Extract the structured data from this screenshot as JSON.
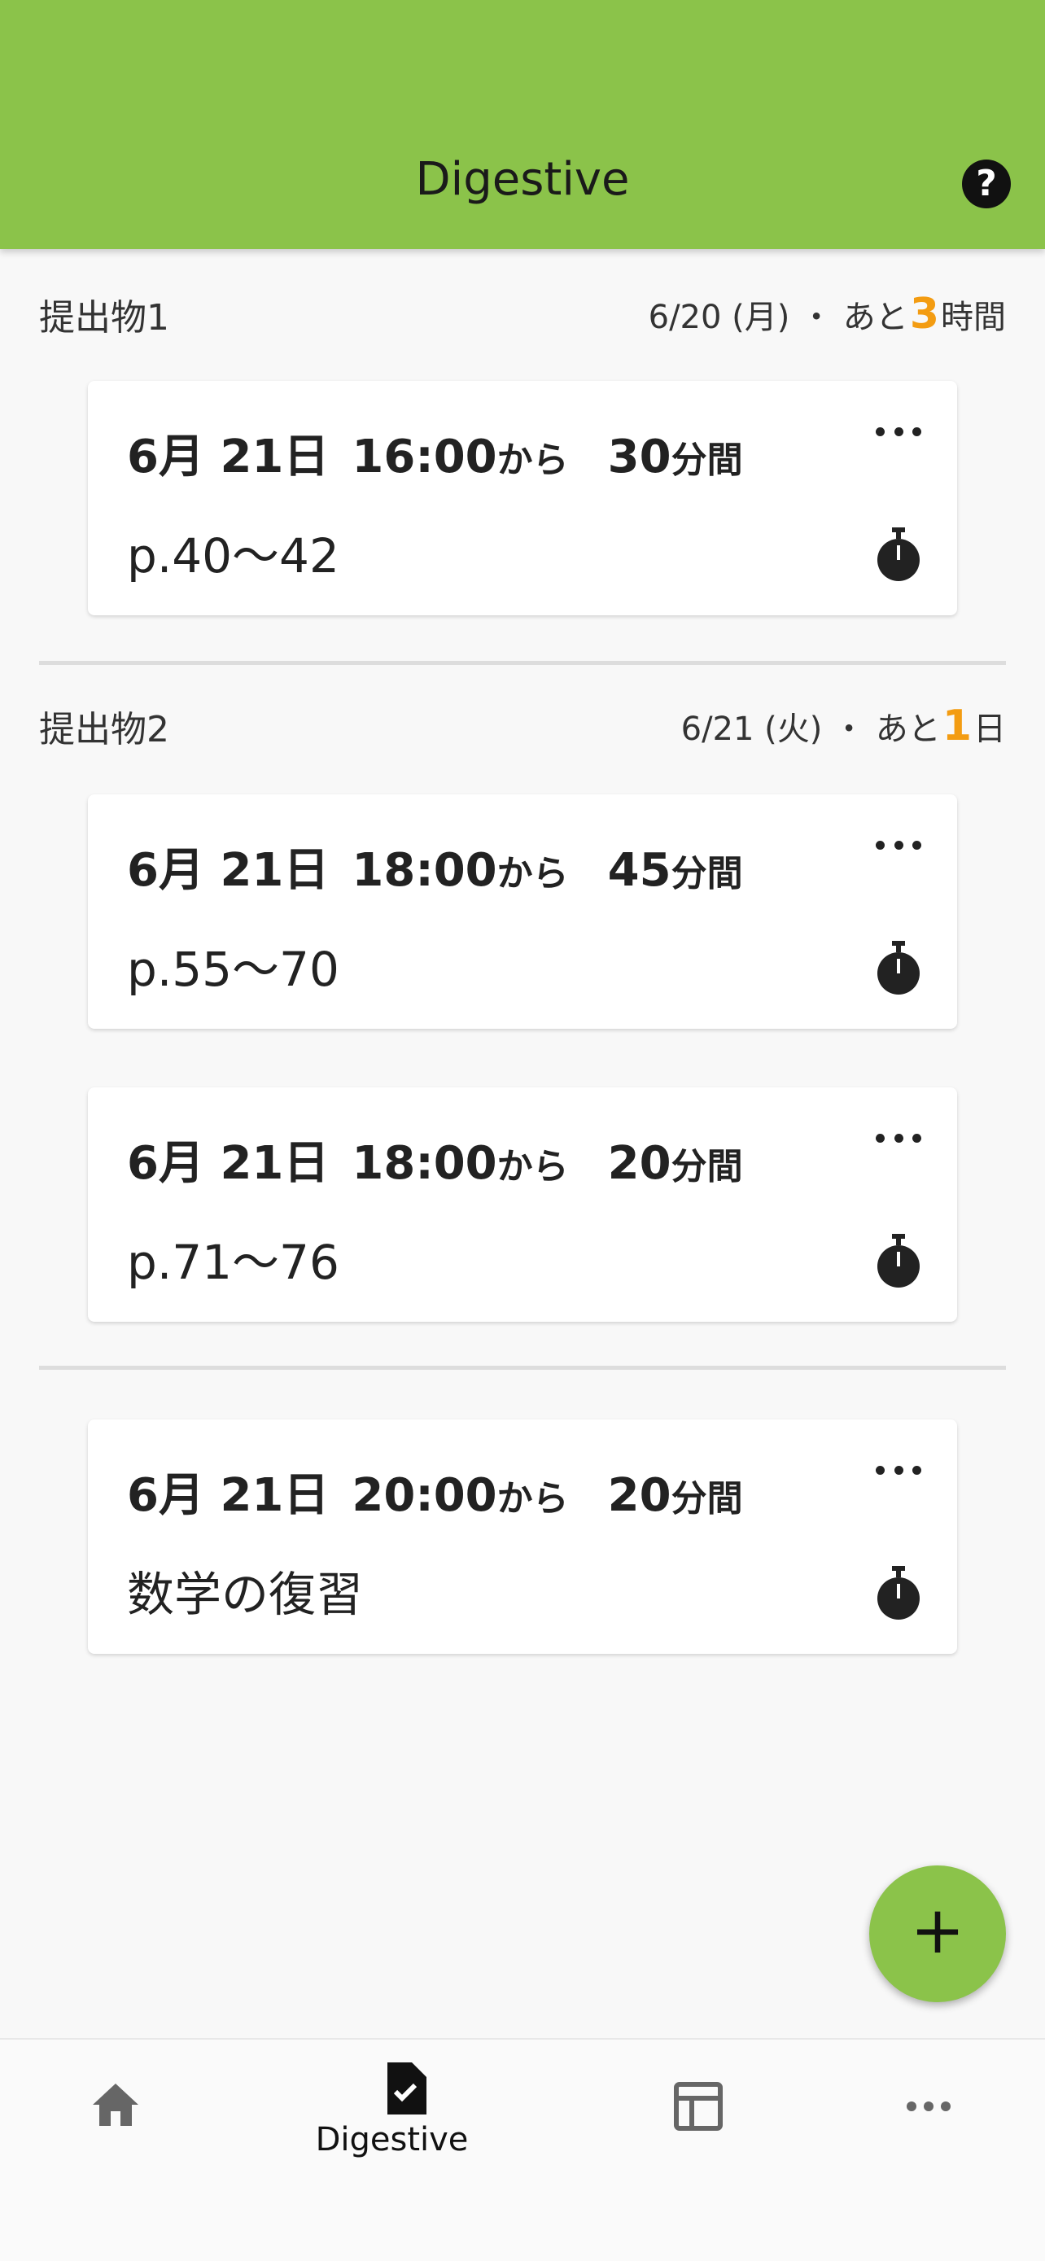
{
  "appbar": {
    "title": "Digestive",
    "help_icon": "help-circle-icon"
  },
  "groups": [
    {
      "name": "提出物1",
      "due_date": "6/20 (月) ・ あと",
      "remaining_num": "3",
      "remaining_unit": "時間",
      "tasks": [
        {
          "date": "6月 21日",
          "time": "16:00",
          "from": "から",
          "duration_num": "30",
          "duration_unit": "分間",
          "range": "p.40〜42"
        }
      ]
    },
    {
      "name": "提出物2",
      "due_date": "6/21 (火) ・ あと",
      "remaining_num": "1",
      "remaining_unit": "日",
      "tasks": [
        {
          "date": "6月 21日",
          "time": "18:00",
          "from": "から",
          "duration_num": "45",
          "duration_unit": "分間",
          "range": "p.55〜70"
        },
        {
          "date": "6月 21日",
          "time": "18:00",
          "from": "から",
          "duration_num": "20",
          "duration_unit": "分間",
          "range": "p.71〜76"
        }
      ]
    }
  ],
  "ungrouped_tasks": [
    {
      "date": "6月 21日",
      "time": "20:00",
      "from": "から",
      "duration_num": "20",
      "duration_unit": "分間",
      "range": "数学の復習"
    }
  ],
  "fab": {
    "label": "+"
  },
  "bottom_nav": {
    "items": [
      {
        "icon": "home-icon",
        "label": ""
      },
      {
        "icon": "assignment-done-icon",
        "label": "Digestive"
      },
      {
        "icon": "table-icon",
        "label": ""
      },
      {
        "icon": "more-horiz-icon",
        "label": ""
      }
    ],
    "active_index": 1
  },
  "colors": {
    "accent": "#8bc34a",
    "highlight": "#f39c12",
    "background": "#f8f8f8"
  }
}
